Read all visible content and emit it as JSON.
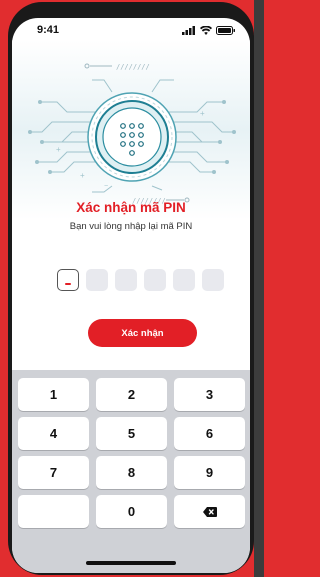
{
  "status_bar": {
    "time": "9:41"
  },
  "header": {
    "title": "Xác nhận mã PIN",
    "subtitle": "Bạn vui lòng nhập lại mã PIN"
  },
  "pin": {
    "length": 6,
    "entered": 0
  },
  "confirm_button": {
    "label": "Xác nhận"
  },
  "keypad": {
    "keys": [
      "1",
      "2",
      "3",
      "4",
      "5",
      "6",
      "7",
      "8",
      "9",
      "",
      "0",
      "backspace-icon"
    ]
  },
  "colors": {
    "accent": "#e21f26",
    "keypad_bg": "#cfd1d6"
  }
}
